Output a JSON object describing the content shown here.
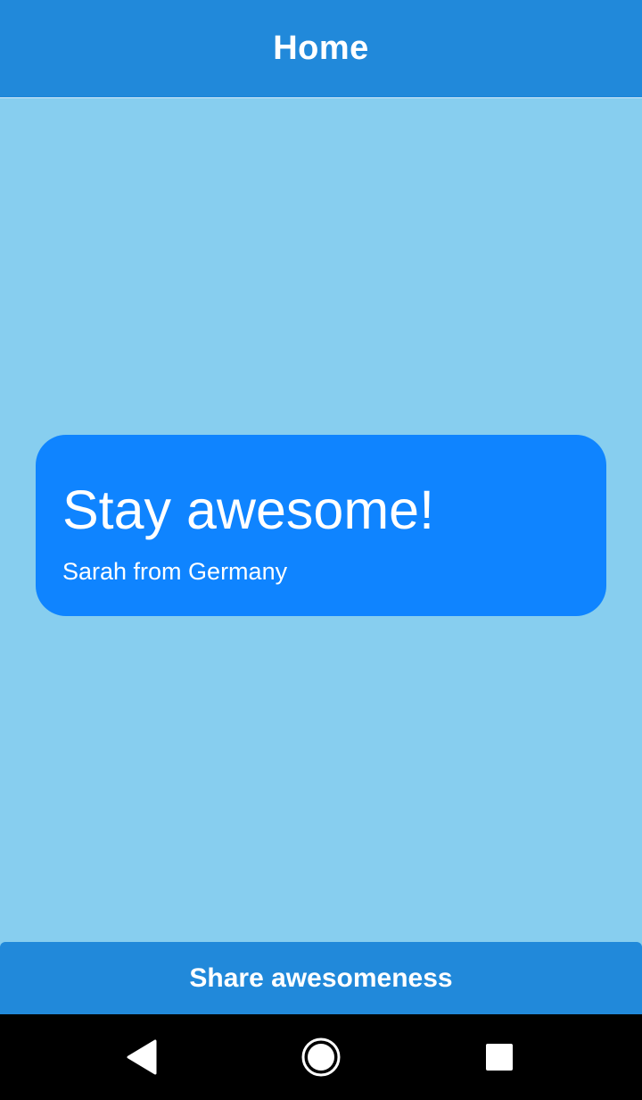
{
  "app_bar": {
    "title": "Home"
  },
  "quote": {
    "text": "Stay awesome!",
    "author": "Sarah from Germany"
  },
  "actions": {
    "share_label": "Share awesomeness"
  },
  "system_nav": {
    "back_icon": "back-triangle-icon",
    "home_icon": "home-circle-icon",
    "recents_icon": "recents-square-icon"
  },
  "colors": {
    "app_bar": "#2189DA",
    "background": "#87CEEF",
    "card": "#0F84FF",
    "button": "#2189DA",
    "nav_bar": "#000000",
    "text": "#FFFFFF"
  }
}
